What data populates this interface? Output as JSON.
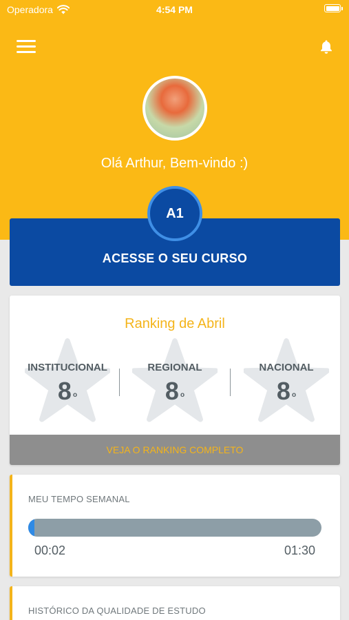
{
  "status_bar": {
    "carrier": "Operadora",
    "time": "4:54 PM",
    "battery_level": 1.0
  },
  "header": {
    "menu_icon": "hamburger-menu-icon",
    "notification_icon": "bell-icon",
    "greeting": "Olá Arthur, Bem-vindo :)",
    "avatar_icon": "user-avatar"
  },
  "course": {
    "level": "A1",
    "label": "ACESSE O SEU CURSO"
  },
  "ranking": {
    "title": "Ranking de Abril",
    "ordinal_suffix": "o",
    "categories": [
      {
        "label": "INSTITUCIONAL",
        "value": "8"
      },
      {
        "label": "REGIONAL",
        "value": "8"
      },
      {
        "label": "NACIONAL",
        "value": "8"
      }
    ],
    "footer_link": "VEJA O RANKING COMPLETO"
  },
  "weekly_time": {
    "label": "MEU TEMPO SEMANAL",
    "current": "00:02",
    "goal": "01:30",
    "progress_fraction": 0.022
  },
  "study_history": {
    "label": "HISTÓRICO DA QUALIDADE DE ESTUDO"
  },
  "colors": {
    "primary_yellow": "#fbb915",
    "accent_yellow": "#f4b41a",
    "primary_blue": "#0b4aa2",
    "badge_ring": "#3f8fe6",
    "progress_fill": "#2f8ae5",
    "progress_track": "#8d9ea7"
  }
}
